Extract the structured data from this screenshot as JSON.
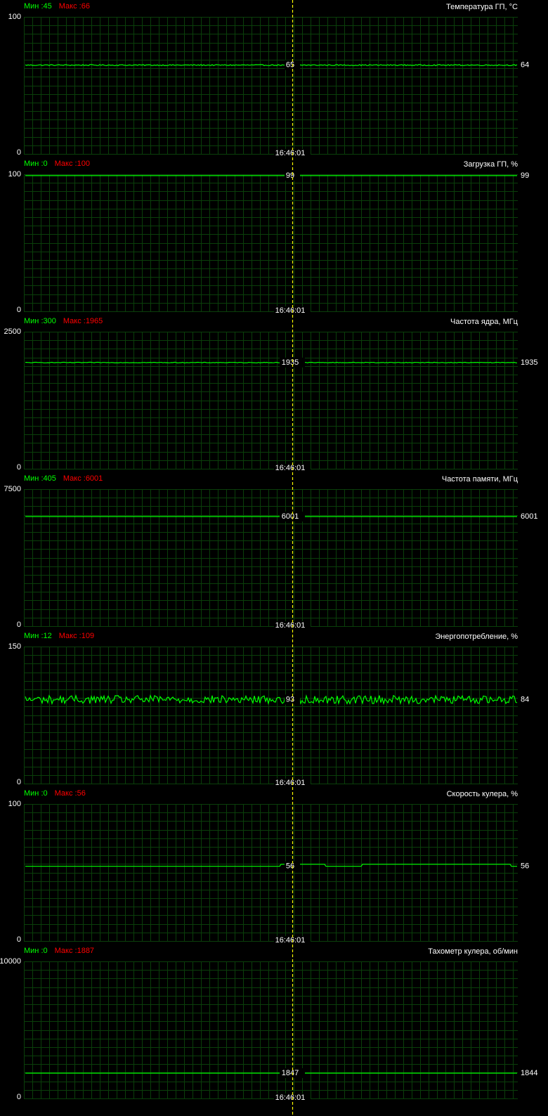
{
  "cursor_time": "16:46:01",
  "labels": {
    "min_prefix": "Мин : ",
    "max_prefix": "Макс : "
  },
  "colors": {
    "background": "#000000",
    "grid": "#0a3f0a",
    "trace": "#00ff00",
    "min_text": "#00ff00",
    "max_text": "#ff0000",
    "text": "#ffffff",
    "cursor": "#ffff00"
  },
  "chart_data": [
    {
      "type": "line",
      "title": "Температура ГП, °C",
      "min_label": "45",
      "max_label": "66",
      "ylim": [
        0,
        100
      ],
      "tick_top": "100",
      "tick_bottom": "0",
      "cursor_value": "65",
      "current_value": "64",
      "baseline": 64.8,
      "noise": 0.4,
      "steps": []
    },
    {
      "type": "line",
      "title": "Загрузка ГП, %",
      "min_label": "0",
      "max_label": "100",
      "ylim": [
        0,
        100
      ],
      "tick_top": "100",
      "tick_bottom": "0",
      "cursor_value": "99",
      "current_value": "99",
      "baseline": 99,
      "noise": 0,
      "steps": []
    },
    {
      "type": "line",
      "title": "Частота ядра, МГц",
      "min_label": "300",
      "max_label": "1965",
      "ylim": [
        0,
        2500
      ],
      "tick_top": "2500",
      "tick_bottom": "0",
      "cursor_value": "1935",
      "current_value": "1935",
      "baseline": 1937,
      "noise": 6,
      "steps": []
    },
    {
      "type": "line",
      "title": "Частота памяти, МГц",
      "min_label": "405",
      "max_label": "6001",
      "ylim": [
        0,
        7500
      ],
      "tick_top": "7500",
      "tick_bottom": "0",
      "cursor_value": "6001",
      "current_value": "6001",
      "baseline": 6001,
      "noise": 0,
      "steps": []
    },
    {
      "type": "line",
      "title": "Энергопотребление, %",
      "min_label": "12",
      "max_label": "109",
      "ylim": [
        0,
        150
      ],
      "tick_top": "150",
      "tick_bottom": "0",
      "cursor_value": "93",
      "current_value": "84",
      "baseline": 92,
      "noise": 4.5,
      "steps": []
    },
    {
      "type": "line",
      "title": "Скорость кулера, %",
      "min_label": "0",
      "max_label": "56",
      "ylim": [
        0,
        100
      ],
      "tick_top": "100",
      "tick_bottom": "0",
      "cursor_value": "56",
      "current_value": "56",
      "baseline": 54.5,
      "noise": 0,
      "steps": [
        {
          "from": 0.0,
          "to": 0.52,
          "value": 54.5
        },
        {
          "from": 0.52,
          "to": 0.61,
          "value": 56.0
        },
        {
          "from": 0.61,
          "to": 0.685,
          "value": 54.5
        },
        {
          "from": 0.685,
          "to": 0.985,
          "value": 56.0
        },
        {
          "from": 0.985,
          "to": 1.0,
          "value": 54.5
        }
      ]
    },
    {
      "type": "line",
      "title": "Тахометр кулера, об/мин",
      "min_label": "0",
      "max_label": "1887",
      "ylim": [
        0,
        10000
      ],
      "tick_top": "10000",
      "tick_bottom": "0",
      "cursor_value": "1847",
      "current_value": "1844",
      "baseline": 1846,
      "noise": 0,
      "steps": []
    }
  ]
}
